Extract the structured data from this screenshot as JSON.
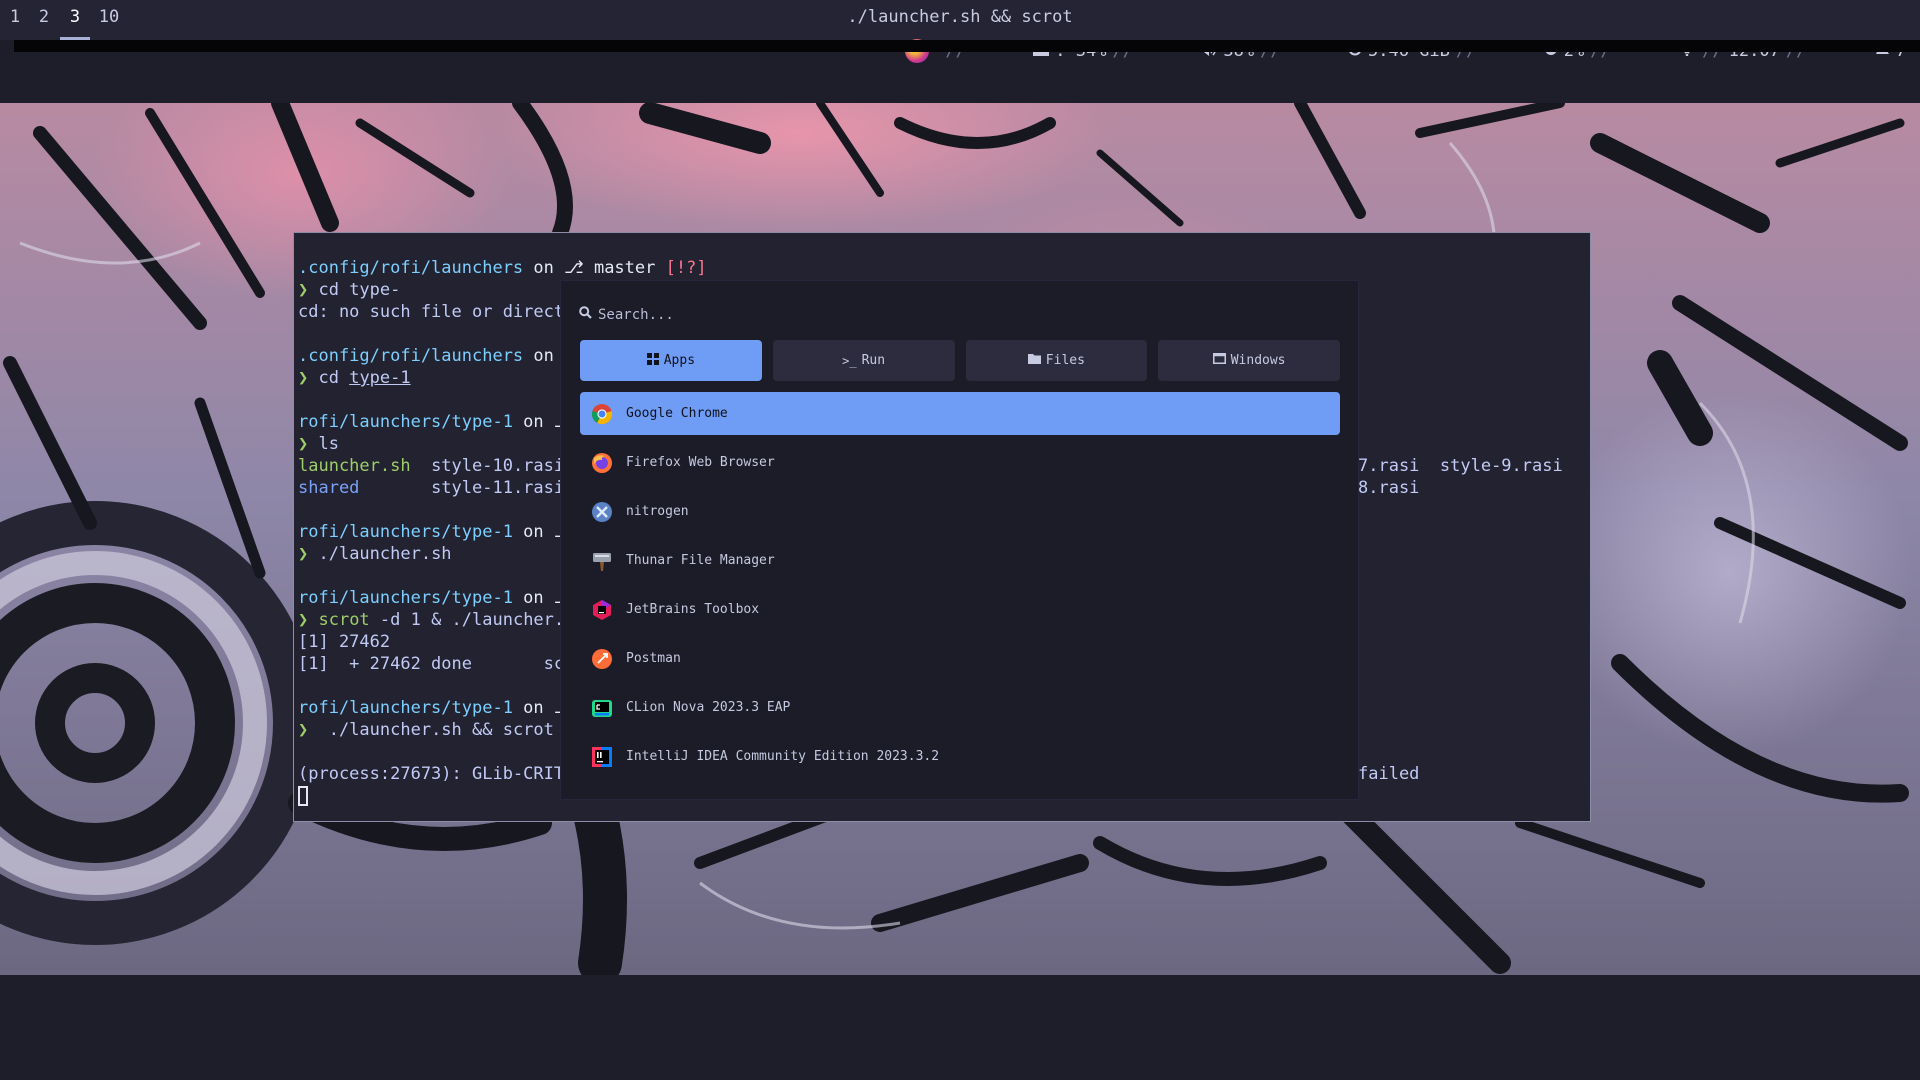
{
  "bar": {
    "workspaces": [
      {
        "label": "1",
        "active": false
      },
      {
        "label": "2",
        "active": false
      },
      {
        "label": "3",
        "active": true
      },
      {
        "label": "10",
        "active": false
      }
    ],
    "title": "./launcher.sh && scrot",
    "separator": "//",
    "disk": ": 34%",
    "volume": "38%",
    "memory": "5.46 GiB",
    "cpu": "2%",
    "time": "12:07",
    "updates": "7"
  },
  "terminal": {
    "l1_path": ".config/rofi/launchers",
    "l1_on": " on ",
    "l1_branch": " master",
    "l1_status": " [!?]",
    "l2_cmd": "cd type-",
    "l3": "cd: no such file or directo",
    "l5_path": ".config/rofi/launchers",
    "l5_on": " on ",
    "l6_cmd": "cd ",
    "l6_arg": "type-1",
    "l8_path": "rofi/launchers/type-1",
    "l8_on": " on ",
    "l9_cmd": "ls",
    "l10_a": "launcher.sh",
    "l10_b": "  style-10.rasi",
    "l10_right_a": "7.rasi",
    "l10_right_b": "  style-9.rasi",
    "l11_a": "shared",
    "l11_b": "       style-11.rasi",
    "l11_right": "8.rasi",
    "l13_path": "rofi/launchers/type-1",
    "l13_on": " on ",
    "l14_cmd": "./launcher.sh",
    "l16_path": "rofi/launchers/type-1",
    "l16_on": " on ",
    "l17_cmd": "scrot",
    "l17_args": " -d 1 & ./launcher.s",
    "l18": "[1] 27462",
    "l19": "[1]  + 27462 done       scr",
    "l21_path": "rofi/launchers/type-1",
    "l21_on": " on ",
    "l22_cmd": " ./launcher.sh && scrot",
    "l24": "(process:27673): GLib-CRIT",
    "l24_right": "failed"
  },
  "rofi": {
    "search_placeholder": "Search...",
    "modes": [
      {
        "label": "Apps",
        "icon": "grid-icon",
        "active": true
      },
      {
        "label": "Run",
        "icon": "terminal-icon",
        "active": false
      },
      {
        "label": "Files",
        "icon": "folder-icon",
        "active": false
      },
      {
        "label": "Windows",
        "icon": "window-icon",
        "active": false
      }
    ],
    "items": [
      {
        "label": "Google Chrome",
        "icon": "chrome-icon",
        "selected": true
      },
      {
        "label": "Firefox Web Browser",
        "icon": "firefox-icon",
        "selected": false
      },
      {
        "label": "nitrogen",
        "icon": "nitrogen-icon",
        "selected": false
      },
      {
        "label": "Thunar File Manager",
        "icon": "thunar-icon",
        "selected": false
      },
      {
        "label": "JetBrains Toolbox",
        "icon": "jetbrains-toolbox-icon",
        "selected": false
      },
      {
        "label": "Postman",
        "icon": "postman-icon",
        "selected": false
      },
      {
        "label": "CLion Nova 2023.3 EAP",
        "icon": "clion-icon",
        "selected": false
      },
      {
        "label": "IntelliJ IDEA Community Edition 2023.3.2",
        "icon": "intellij-icon",
        "selected": false
      }
    ]
  },
  "colors": {
    "accent": "#6f9cf4",
    "terminal_bg": "#222230",
    "rofi_bg": "#1c1c28",
    "bar_bg": "#242434"
  }
}
